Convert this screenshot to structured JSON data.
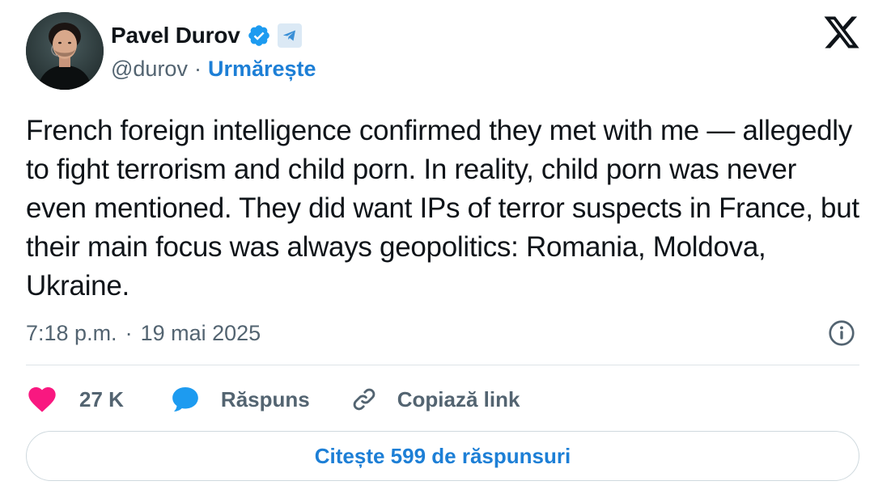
{
  "author": {
    "name": "Pavel Durov",
    "handle": "@durov",
    "separator": "·",
    "follow_label": "Urmărește",
    "verified_icon": "verified-badge-icon",
    "affiliate_icon": "telegram-icon",
    "brand_logo": "x-logo-icon"
  },
  "tweet": {
    "text": "French foreign intelligence confirmed they met with me — allegedly to fight terrorism and child porn. In reality, child porn was never even mentioned. They did want IPs of terror suspects in France, but their main focus was always geopolitics: Romania, Moldova, Ukraine.",
    "time": "7:18 p.m.",
    "separator": "·",
    "date": "19 mai 2025"
  },
  "actions": {
    "like_count": "27 K",
    "reply_label": "Răspuns",
    "copy_label": "Copiază link"
  },
  "replies_button": {
    "label": "Citește 599 de răspunsuri"
  },
  "colors": {
    "accent_blue": "#1d7fd6",
    "like_pink": "#f91880",
    "reply_blue": "#1d9bf0",
    "muted_text": "#536471",
    "text": "#0f1419",
    "border": "#cfd9de"
  }
}
